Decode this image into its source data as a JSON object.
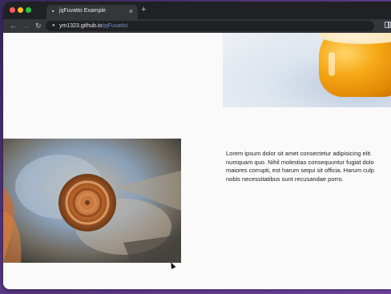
{
  "window": {
    "colors": {
      "chrome": "#202124",
      "toolbar": "#35363a",
      "page": "#fafafa"
    }
  },
  "tabs": [
    {
      "title": "jqFuvatto Example",
      "favicon": "page-icon",
      "close": "×"
    }
  ],
  "new_tab_label": "+",
  "toolbar": {
    "back": "←",
    "forward": "→",
    "reload": "↻",
    "url_host": "ym1323.github.io",
    "url_path": "/jqFuvatto/"
  },
  "content": {
    "images": [
      {
        "name": "beer-glass-image",
        "alt": ""
      },
      {
        "name": "ammonite-fossil-image",
        "alt": ""
      }
    ],
    "paragraph_lines": [
      "Lorem ipsum dolor sit amet consectetur adipisicing elit.",
      "numquam quo. Nihil molestias consequuntur fugiat dolo",
      "maiores corrupti, est harum sequi sit officia. Harum culp",
      "nobis necessitatibus sunt recusandae porro."
    ]
  }
}
